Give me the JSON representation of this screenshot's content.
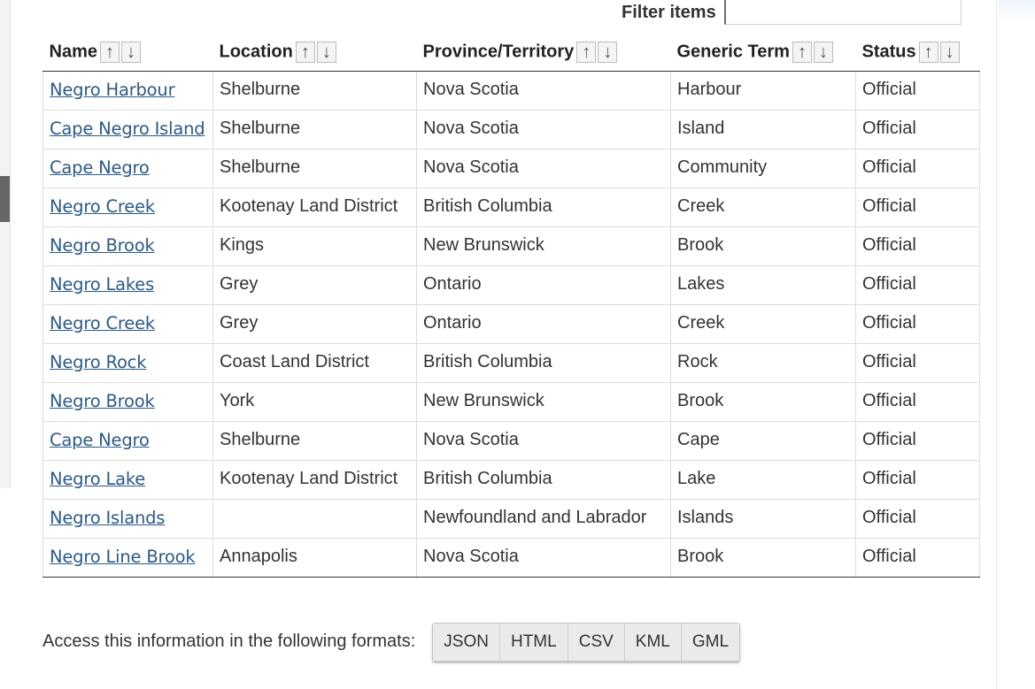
{
  "filter": {
    "label": "Filter items",
    "value": ""
  },
  "table": {
    "columns": [
      "Name",
      "Location",
      "Province/Territory",
      "Generic Term",
      "Status"
    ],
    "sort_icons": {
      "up": "↑",
      "down": "↓"
    },
    "rows": [
      [
        "Negro Harbour",
        "Shelburne",
        "Nova Scotia",
        "Harbour",
        "Official"
      ],
      [
        "Cape Negro Island",
        "Shelburne",
        "Nova Scotia",
        "Island",
        "Official"
      ],
      [
        "Cape Negro",
        "Shelburne",
        "Nova Scotia",
        "Community",
        "Official"
      ],
      [
        "Negro Creek",
        "Kootenay Land District",
        "British Columbia",
        "Creek",
        "Official"
      ],
      [
        "Negro Brook",
        "Kings",
        "New Brunswick",
        "Brook",
        "Official"
      ],
      [
        "Negro Lakes",
        "Grey",
        "Ontario",
        "Lakes",
        "Official"
      ],
      [
        "Negro Creek",
        "Grey",
        "Ontario",
        "Creek",
        "Official"
      ],
      [
        "Negro Rock",
        "Coast Land District",
        "British Columbia",
        "Rock",
        "Official"
      ],
      [
        "Negro Brook",
        "York",
        "New Brunswick",
        "Brook",
        "Official"
      ],
      [
        "Cape Negro",
        "Shelburne",
        "Nova Scotia",
        "Cape",
        "Official"
      ],
      [
        "Negro Lake",
        "Kootenay Land District",
        "British Columbia",
        "Lake",
        "Official"
      ],
      [
        "Negro Islands",
        "",
        "Newfoundland and Labrador",
        "Islands",
        "Official"
      ],
      [
        "Negro Line Brook",
        "Annapolis",
        "Nova Scotia",
        "Brook",
        "Official"
      ]
    ]
  },
  "formats": {
    "label": "Access this information in the following formats:",
    "buttons": [
      "JSON",
      "HTML",
      "CSV",
      "KML",
      "GML"
    ]
  },
  "colors": {
    "link": "#295a8a",
    "button_bg": "#eaeaea",
    "border": "#dddddd"
  }
}
